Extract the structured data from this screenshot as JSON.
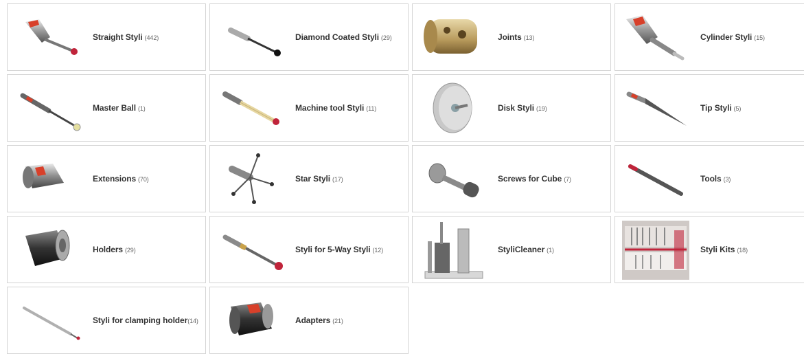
{
  "categories": [
    {
      "name": "Straight Styli",
      "count": "(442)",
      "icon": "straight-stylus-icon"
    },
    {
      "name": "Diamond Coated Styli",
      "count": "(29)",
      "icon": "diamond-coated-stylus-icon"
    },
    {
      "name": "Joints",
      "count": "(13)",
      "icon": "joint-icon"
    },
    {
      "name": "Cylinder Styli",
      "count": "(15)",
      "icon": "cylinder-stylus-icon"
    },
    {
      "name": "Master Ball",
      "count": "(1)",
      "icon": "master-ball-icon"
    },
    {
      "name": "Machine tool Styli",
      "count": "(11)",
      "icon": "machine-tool-stylus-icon"
    },
    {
      "name": "Disk Styli",
      "count": "(19)",
      "icon": "disk-stylus-icon"
    },
    {
      "name": "Tip Styli",
      "count": "(5)",
      "icon": "tip-stylus-icon"
    },
    {
      "name": "Extensions",
      "count": "(70)",
      "icon": "extension-icon"
    },
    {
      "name": "Star Styli",
      "count": "(17)",
      "icon": "star-stylus-icon"
    },
    {
      "name": "Screws for Cube",
      "count": "(7)",
      "icon": "screw-icon"
    },
    {
      "name": "Tools",
      "count": "(3)",
      "icon": "tool-icon"
    },
    {
      "name": "Holders",
      "count": "(29)",
      "icon": "holder-icon"
    },
    {
      "name": "Styli for 5-Way Styli",
      "count": "(12)",
      "icon": "five-way-stylus-icon"
    },
    {
      "name": "StyliCleaner",
      "count": "(1)",
      "icon": "styli-cleaner-icon"
    },
    {
      "name": "Styli Kits",
      "count": "(18)",
      "icon": "styli-kit-icon"
    },
    {
      "name": "Styli for clamping holder",
      "count": "(14)",
      "icon": "clamping-holder-stylus-icon"
    },
    {
      "name": "Adapters",
      "count": "(21)",
      "icon": "adapter-icon"
    }
  ],
  "colors": {
    "border": "#d4d4d4",
    "text": "#333333",
    "count_text": "#666666",
    "ruby": "#c0243a",
    "accent_red": "#d8402a"
  }
}
